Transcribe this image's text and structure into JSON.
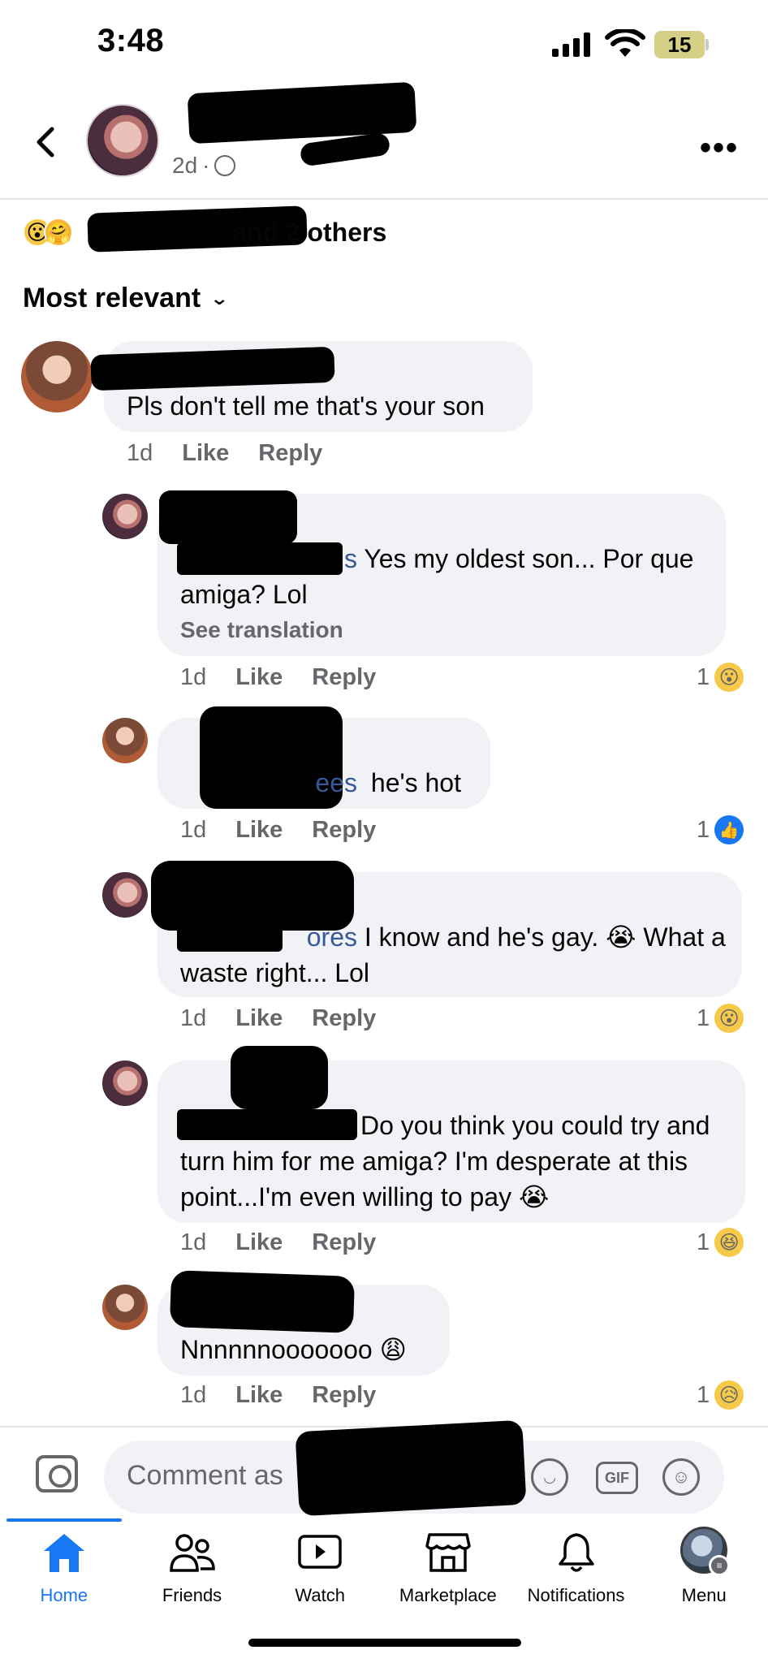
{
  "status_bar": {
    "time": "3:48",
    "battery": "15"
  },
  "post_header": {
    "time": "2d",
    "more_label": "•••"
  },
  "reactions_summary": {
    "text": "and 2 others"
  },
  "sort": {
    "label": "Most relevant"
  },
  "comments": [
    {
      "text": "Pls don't tell me that's your son",
      "time": "1d",
      "like": "Like",
      "reply": "Reply"
    },
    {
      "mention": "s",
      "text": "Yes my oldest son... Por que amiga? Lol",
      "see_translation": "See translation",
      "time": "1d",
      "like": "Like",
      "reply": "Reply",
      "reaction_count": "1",
      "reaction": "wow"
    },
    {
      "mention": "ees",
      "text": "he's hot",
      "time": "1d",
      "like": "Like",
      "reply": "Reply",
      "reaction_count": "1",
      "reaction": "like"
    },
    {
      "mention": "ores",
      "text": "I know and he's gay. 😭 What a waste right... Lol",
      "time": "1d",
      "like": "Like",
      "reply": "Reply",
      "reaction_count": "1",
      "reaction": "wow"
    },
    {
      "text": "Do you think you could try and turn him for me amiga? I'm desperate at this point...I'm even willing to pay 😭",
      "time": "1d",
      "like": "Like",
      "reply": "Reply",
      "reaction_count": "1",
      "reaction": "haha"
    },
    {
      "text": "Nnnnnnooooooo 😩",
      "time": "1d",
      "like": "Like",
      "reply": "Reply",
      "reaction_count": "1",
      "reaction": "sad"
    }
  ],
  "comment_bar": {
    "placeholder": "Comment as",
    "gif": "GIF"
  },
  "nav": [
    {
      "label": "Home",
      "icon": "home-icon",
      "active": true
    },
    {
      "label": "Friends",
      "icon": "friends-icon"
    },
    {
      "label": "Watch",
      "icon": "watch-icon"
    },
    {
      "label": "Marketplace",
      "icon": "marketplace-icon"
    },
    {
      "label": "Notifications",
      "icon": "bell-icon"
    },
    {
      "label": "Menu",
      "icon": "menu-avatar-icon"
    }
  ],
  "colors": {
    "accent": "#1877f2",
    "bubble": "#f0f2f5",
    "secondary_text": "#65676b",
    "mention": "#385898"
  }
}
